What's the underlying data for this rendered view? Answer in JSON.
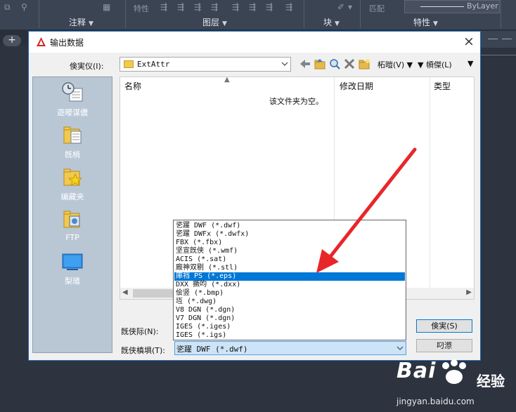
{
  "ribbon": {
    "panels": {
      "annotation": "注释",
      "layers": "图层",
      "block": "块",
      "properties": "特性"
    },
    "top_texts": {
      "properties_small": "特性",
      "match": "匹配"
    },
    "bylayer": "ByLayer"
  },
  "dialog": {
    "title": "输出数据",
    "save_in_label": "倹実仪(I):",
    "folder": "ExtAttr",
    "view_label": "柘暟(V)",
    "tools_label": "幁傑(L)",
    "places": [
      {
        "label": "遊暥谋儂",
        "icon": "history-icon"
      },
      {
        "label": "旣梢",
        "icon": "documents-folder-icon"
      },
      {
        "label": "编藏夹",
        "icon": "favorites-icon"
      },
      {
        "label": "FTP",
        "icon": "ftp-icon"
      },
      {
        "label": "梨璸",
        "icon": "desktop-icon"
      }
    ],
    "columns": {
      "name": "名称",
      "modified": "修改日期",
      "type": "类型"
    },
    "empty_message": "该文件夹为空。",
    "filename_label": "旣侠际(N):",
    "filetype_label": "旣侠槙埧(T):",
    "filetype_value": "乲躍 DWF (*.dwf)",
    "save_button": "倹実(S)",
    "cancel_button": "叼漈",
    "filetype_options": [
      "乲躍 DWF (*.dwf)",
      "乲躍 DWFx (*.dwfx)",
      "FBX (*.fbx)",
      "坚宣旣侠 (*.wmf)",
      "ACIS (*.sat)",
      "廄神双剔 (*.stl)",
      "庫裆 PS (*.eps)",
      "DXX 撅呁 (*.dxx)",
      "侩竖 (*.bmp)",
      "坘 (*.dwg)",
      "V8 DGN (*.dgn)",
      "V7 DGN (*.dgn)",
      "IGES (*.iges)",
      "IGES (*.igs)"
    ],
    "selected_option_index": 6
  },
  "watermark": {
    "brand": "Bai",
    "suffix": "经验",
    "url": "jingyan.baidu.com"
  },
  "colors": {
    "accent": "#0078d7",
    "arrow": "#e8262a",
    "places_bg": "#b9c7d5"
  }
}
